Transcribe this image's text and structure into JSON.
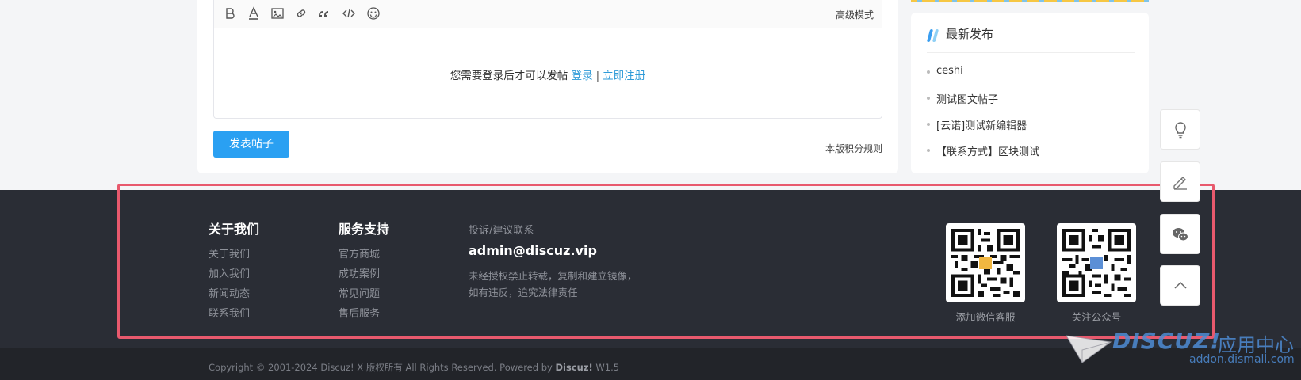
{
  "editor": {
    "advanced_mode": "高级模式",
    "login_prompt": "您需要登录后才可以发帖",
    "login_link": "登录",
    "separator": "|",
    "register_link": "立即注册",
    "post_button": "发表帖子",
    "rules_link": "本版积分规则",
    "toolbar_icons": [
      "bold-icon",
      "font-color-icon",
      "image-icon",
      "link-icon",
      "quote-icon",
      "code-icon",
      "emoji-icon"
    ]
  },
  "sidebar": {
    "title": "最新发布",
    "items": [
      "ceshi",
      "测试图文帖子",
      "[云诺]测试新编辑器",
      "【联系方式】区块测试"
    ]
  },
  "footer": {
    "about": {
      "title": "关于我们",
      "links": [
        "关于我们",
        "加入我们",
        "新闻动态",
        "联系我们"
      ]
    },
    "service": {
      "title": "服务支持",
      "links": [
        "官方商城",
        "成功案例",
        "常见问题",
        "售后服务"
      ]
    },
    "contact": {
      "title": "投诉/建议联系",
      "email": "admin@discuz.vip",
      "note_line1": "未经授权禁止转载，复制和建立镜像，",
      "note_line2": "如有违反，追究法律责任"
    },
    "qr_wechat_label": "添加微信客服",
    "qr_official_label": "关注公众号",
    "copyright": "Copyright © 2001-2024 Discuz! X 版权所有 All Rights Reserved. Powered by",
    "powered_brand": "Discuz!",
    "version": "W1.5"
  },
  "watermark": {
    "brand": "DISCUZ!",
    "brand_cn": "应用中心",
    "url": "addon.dismall.com"
  },
  "colors": {
    "accent": "#2aa0f2",
    "link": "#2f9bd8",
    "footer_bg": "#2a2d35",
    "highlight": "#e8596d"
  }
}
